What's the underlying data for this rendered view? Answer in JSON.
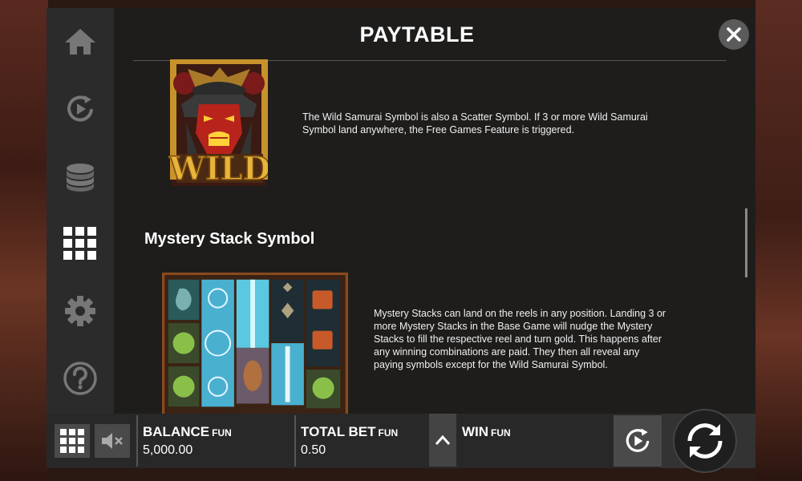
{
  "header": {
    "title": "PAYTABLE"
  },
  "sidebar": {
    "items": [
      {
        "name": "home",
        "icon": "home-icon"
      },
      {
        "name": "autoplay",
        "icon": "play-circle-icon"
      },
      {
        "name": "bet",
        "icon": "coin-stack-icon"
      },
      {
        "name": "paytable",
        "icon": "grid-icon",
        "active": true
      },
      {
        "name": "settings",
        "icon": "gear-icon"
      },
      {
        "name": "help",
        "icon": "help-icon"
      }
    ]
  },
  "paytable": {
    "wild_description": "The Wild Samurai Symbol is also a Scatter Symbol. If 3 or more Wild Samurai Symbol land anywhere, the Free Games Feature is triggered.",
    "wild_symbol_text": "WILD",
    "mystery_heading": "Mystery Stack Symbol",
    "mystery_description": "Mystery Stacks can land on the reels in any position. Landing 3 or more Mystery Stacks in the Base Game will nudge the Mystery Stacks to fill the respective reel and turn gold. This happens after any winning combinations are paid. They then all reveal any paying symbols except for the Wild Samurai Symbol."
  },
  "bottom_bar": {
    "balance_label": "BALANCE",
    "balance_currency": "FUN",
    "balance_value": "5,000.00",
    "total_bet_label": "TOTAL BET",
    "total_bet_currency": "FUN",
    "total_bet_value": "0.50",
    "win_label": "WIN",
    "win_currency": "FUN"
  },
  "colors": {
    "panel_bg": "#1e1d1c",
    "sidebar_bg": "#2b2b2b",
    "bar_bg": "#282828",
    "text": "#ffffff"
  }
}
